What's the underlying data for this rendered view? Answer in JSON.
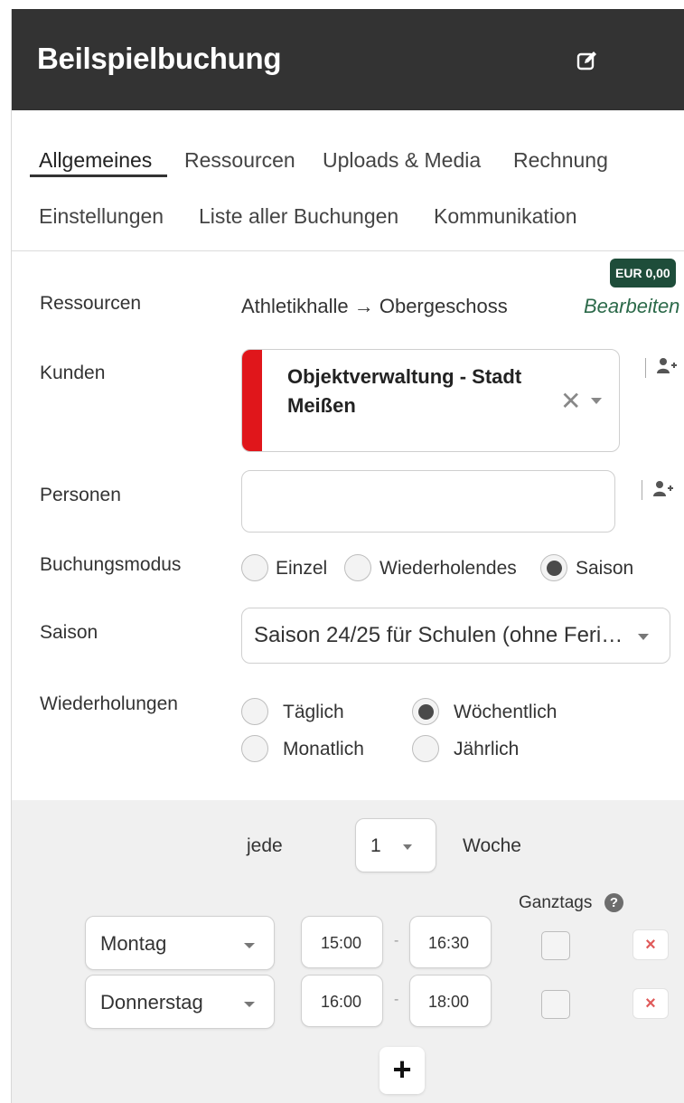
{
  "header": {
    "title": "Beilspielbuchung",
    "edit_icon": "edit-icon"
  },
  "tabs": [
    {
      "label": "Allgemeines",
      "active": true
    },
    {
      "label": "Ressourcen"
    },
    {
      "label": "Uploads & Media"
    },
    {
      "label": "Rechnung"
    },
    {
      "label": "Einstellungen"
    },
    {
      "label": "Liste aller Buchungen"
    },
    {
      "label": "Kommunikation"
    }
  ],
  "form": {
    "ressourcen": {
      "label": "Ressourcen",
      "value": "Athletikhalle → Obergeschoss",
      "price": "EUR 0,00",
      "edit_link": "Bearbeiten"
    },
    "kunden": {
      "label": "Kunden",
      "name": "Objektverwaltung - Stadt Meißen",
      "stripe_color": "#e0161b"
    },
    "personen": {
      "label": "Personen",
      "value": ""
    },
    "buchungsmodus": {
      "label": "Buchungsmodus",
      "options": [
        "Einzel",
        "Wiederholendes",
        "Saison"
      ],
      "selected": "Saison"
    },
    "saison": {
      "label": "Saison",
      "value": "Saison 24/25 für Schulen (ohne Feri…"
    },
    "wiederholungen": {
      "label": "Wiederholungen",
      "options": [
        "Täglich",
        "Wöchentlich",
        "Monatlich",
        "Jährlich"
      ],
      "selected": "Wöchentlich"
    }
  },
  "repeat": {
    "every_label": "jede",
    "interval": "1",
    "unit_label": "Woche",
    "allday_label": "Ganztags",
    "help_icon": "?",
    "separator": "-",
    "rows": [
      {
        "day": "Montag",
        "from": "15:00",
        "to": "16:30",
        "allday": false
      },
      {
        "day": "Donnerstag",
        "from": "16:00",
        "to": "18:00",
        "allday": false
      }
    ],
    "delete_symbol": "×",
    "add_symbol": "+"
  },
  "colors": {
    "header_bg": "#333333",
    "accent_green": "#1e4d3a",
    "link_green": "#2c6a4a",
    "customer_stripe": "#e0161b"
  }
}
